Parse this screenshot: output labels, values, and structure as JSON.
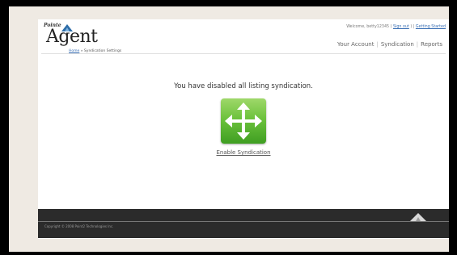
{
  "header": {
    "logo_small": "Pointe",
    "logo_main": "Agent",
    "breadcrumb": {
      "home": "Home",
      "separator": " » ",
      "current": "Syndication Settings"
    },
    "welcome": {
      "prefix": "Welcome, betty12345 ( ",
      "sign_out": "Sign out",
      "middle": " ) | ",
      "getting_started": "Getting Started"
    },
    "nav": [
      {
        "label": "Your Account"
      },
      {
        "label": "Syndication"
      },
      {
        "label": "Reports"
      }
    ]
  },
  "main": {
    "message": "You have disabled all listing syndication.",
    "enable_label": "Enable Syndication"
  },
  "footer": {
    "copyright": "Copyright © 2008 Point2 Technologies Inc."
  },
  "colors": {
    "link": "#3a6fb4",
    "tile_green": "#6cc23c",
    "footer_bg": "#2b2b2b",
    "frame_bg": "#efeae3"
  },
  "icons": {
    "logo_peak": "mountain-peak-icon",
    "tile": "four-way-arrows-icon",
    "footer": "mountain-peak-icon"
  }
}
